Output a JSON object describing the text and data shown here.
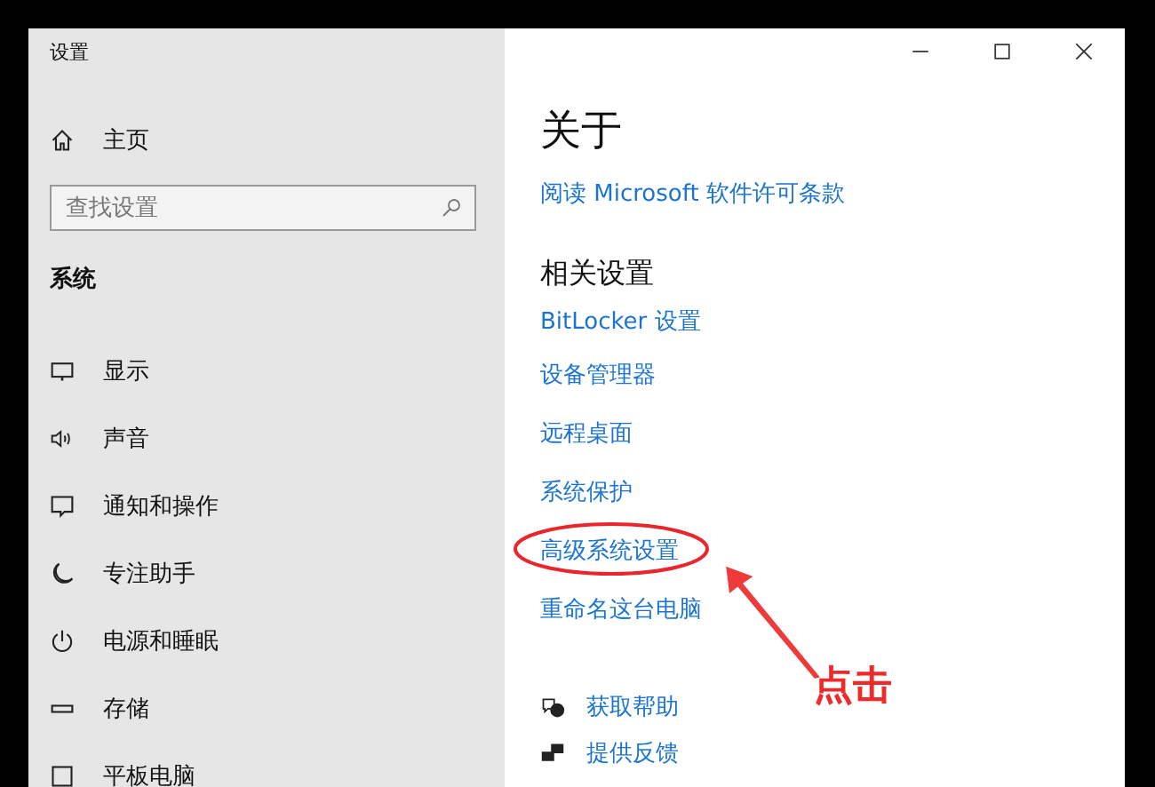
{
  "window": {
    "title": "设置"
  },
  "sidebar": {
    "home": "主页",
    "search": {
      "placeholder": "查找设置"
    },
    "section": "系统",
    "items": [
      {
        "label": "显示",
        "kind": "display"
      },
      {
        "label": "声音",
        "kind": "sound"
      },
      {
        "label": "通知和操作",
        "kind": "notify"
      },
      {
        "label": "专注助手",
        "kind": "moon"
      },
      {
        "label": "电源和睡眠",
        "kind": "power"
      },
      {
        "label": "存储",
        "kind": "storage"
      },
      {
        "label": "平板电脑",
        "kind": "tablet"
      }
    ]
  },
  "content": {
    "title": "关于",
    "license_link": "阅读 Microsoft 软件许可条款",
    "related_heading": "相关设置",
    "related_links": [
      {
        "label": "BitLocker 设置",
        "highlighted": false
      },
      {
        "label": "设备管理器",
        "highlighted": false
      },
      {
        "label": "远程桌面",
        "highlighted": false
      },
      {
        "label": "系统保护",
        "highlighted": false
      },
      {
        "label": "高级系统设置",
        "highlighted": true
      },
      {
        "label": "重命名这台电脑",
        "highlighted": false
      }
    ],
    "help_links": [
      {
        "label": "获取帮助",
        "kind": "help"
      },
      {
        "label": "提供反馈",
        "kind": "feedback"
      }
    ]
  },
  "annotation": {
    "text": "点击"
  }
}
